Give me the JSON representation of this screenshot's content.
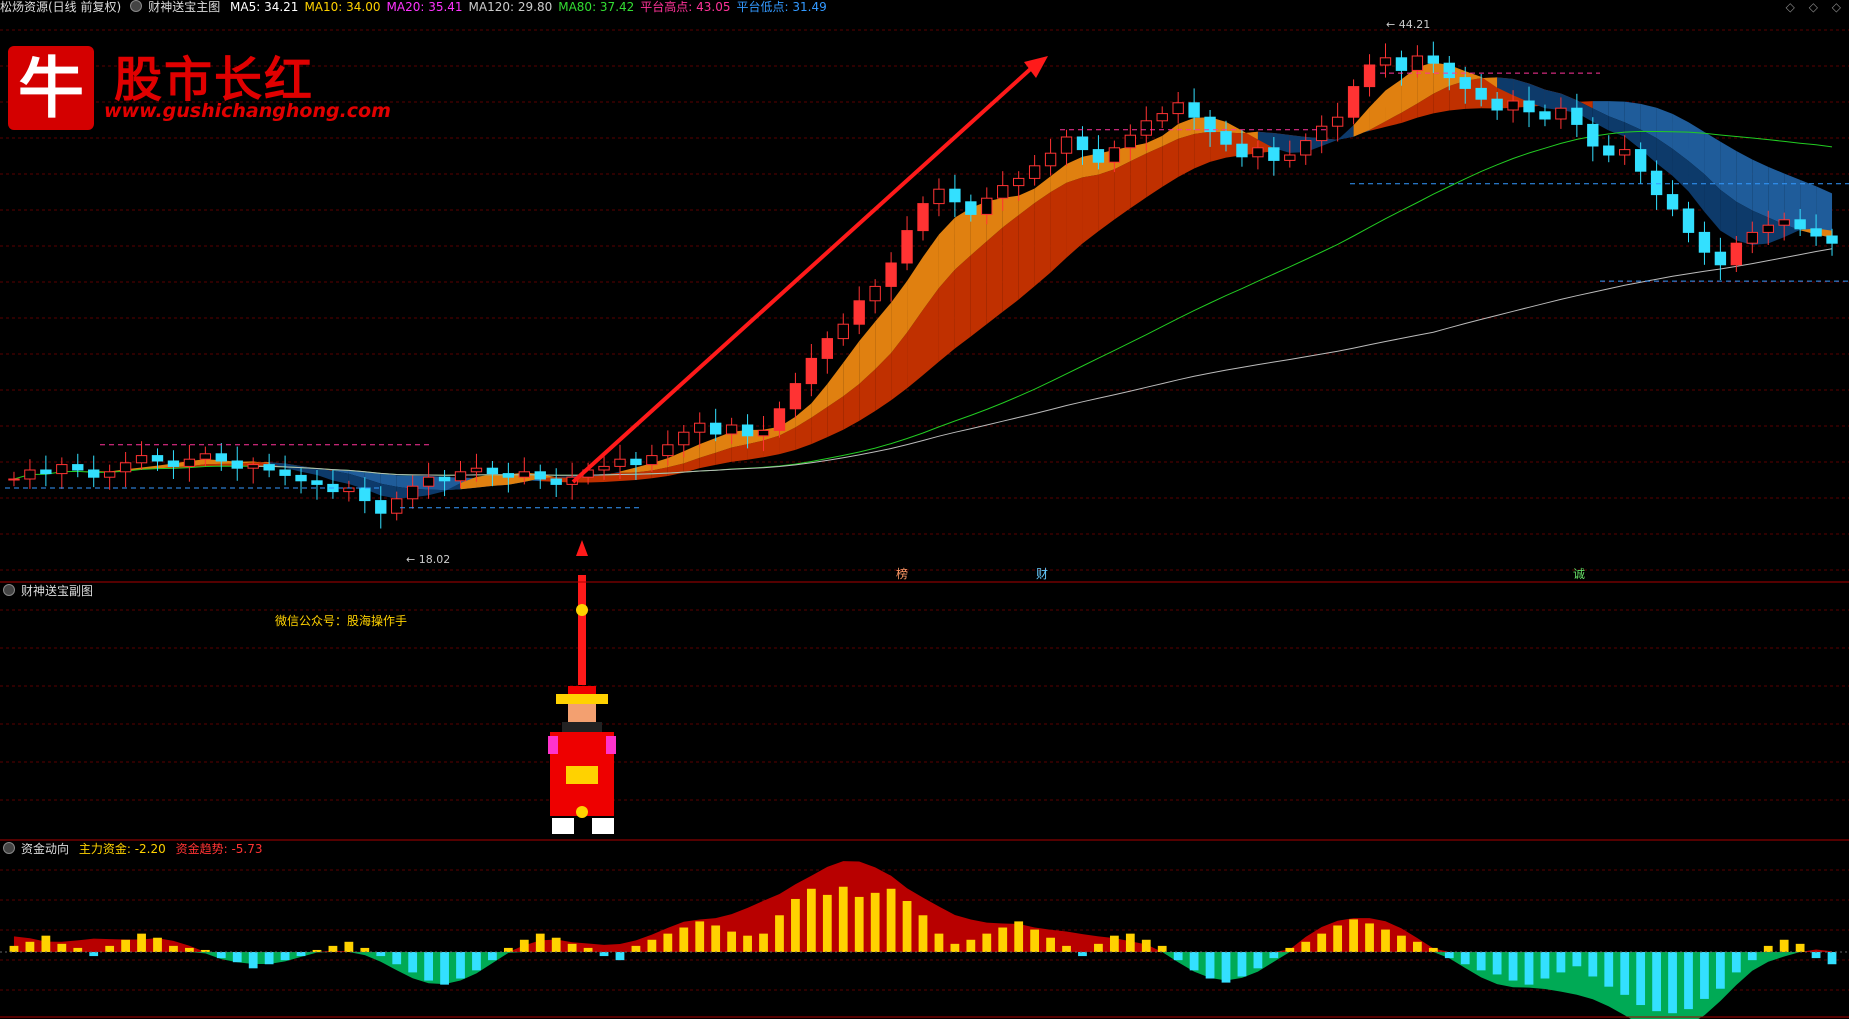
{
  "header": {
    "title": "松炀资源(日线 前复权)",
    "indicator_main": "财神送宝主图",
    "ma": [
      {
        "label": "MA5: 34.21",
        "color": "#ffffff"
      },
      {
        "label": "MA10: 34.00",
        "color": "#ffd200"
      },
      {
        "label": "MA20: 35.41",
        "color": "#ff33ff"
      },
      {
        "label": "MA120: 29.80",
        "color": "#cccccc"
      },
      {
        "label": "MA80: 37.42",
        "color": "#33dd33"
      },
      {
        "label": "平台高点: 43.05",
        "color": "#ff3399"
      },
      {
        "label": "平台低点: 31.49",
        "color": "#3399ff"
      }
    ],
    "right_icons": [
      "◇",
      "◇",
      "◇"
    ]
  },
  "logo": {
    "glyph": "牛",
    "name": "股市长红",
    "url": "www.gushichanghong.com"
  },
  "subchart": {
    "title": "财神送宝副图",
    "wechat": "微信公众号：股海操作手"
  },
  "flow": {
    "title": "资金动向",
    "main_label": "主力资金: -2.20",
    "trend_label": "资金趋势: -5.73",
    "main_color": "#ffd200",
    "trend_color": "#ff3333"
  },
  "markers": [
    {
      "text": "榜",
      "color": "#ff9966"
    },
    {
      "text": "财",
      "color": "#66ccff"
    },
    {
      "text": "诚",
      "color": "#66dd66"
    }
  ],
  "chart_data": {
    "type": "candlestick",
    "price_range": [
      16,
      46
    ],
    "high_label": "44.21",
    "low_label": "18.02",
    "closes": [
      20.5,
      21.0,
      20.8,
      21.3,
      21.0,
      20.6,
      20.9,
      21.4,
      21.8,
      21.5,
      21.2,
      21.6,
      21.9,
      21.5,
      21.1,
      21.3,
      21.0,
      20.7,
      20.4,
      20.2,
      19.8,
      20.0,
      19.3,
      18.6,
      19.4,
      20.1,
      20.6,
      20.4,
      20.9,
      21.1,
      20.8,
      20.6,
      20.9,
      20.5,
      20.2,
      20.6,
      21.0,
      21.2,
      21.6,
      21.3,
      21.8,
      22.4,
      23.1,
      23.6,
      23.0,
      23.5,
      22.9,
      23.2,
      24.4,
      25.8,
      27.2,
      28.3,
      29.1,
      30.4,
      31.2,
      32.5,
      34.3,
      35.8,
      36.6,
      35.9,
      35.2,
      36.1,
      36.8,
      37.2,
      37.9,
      38.6,
      39.5,
      38.8,
      38.1,
      38.9,
      39.6,
      40.4,
      40.8,
      41.4,
      40.6,
      39.8,
      39.1,
      38.4,
      38.9,
      38.2,
      38.5,
      39.3,
      40.1,
      40.6,
      42.3,
      43.5,
      43.9,
      43.2,
      44.0,
      43.6,
      42.8,
      42.2,
      41.6,
      41.0,
      41.5,
      40.9,
      40.5,
      41.1,
      40.2,
      39.0,
      38.5,
      38.8,
      37.6,
      36.3,
      35.5,
      34.2,
      33.1,
      32.4,
      33.6,
      34.2,
      34.6,
      34.9,
      34.4,
      34.0,
      33.6
    ],
    "flow_values": [
      0.3,
      0.5,
      0.8,
      0.4,
      0.2,
      -0.2,
      0.3,
      0.6,
      0.9,
      0.7,
      0.3,
      0.2,
      0.1,
      -0.3,
      -0.5,
      -0.8,
      -0.6,
      -0.4,
      -0.2,
      0.1,
      0.3,
      0.5,
      0.2,
      -0.2,
      -0.6,
      -1.0,
      -1.4,
      -1.6,
      -1.3,
      -0.9,
      -0.4,
      0.2,
      0.6,
      0.9,
      0.7,
      0.4,
      0.2,
      -0.2,
      -0.4,
      0.3,
      0.6,
      0.9,
      1.2,
      1.5,
      1.3,
      1.0,
      0.8,
      0.9,
      1.8,
      2.6,
      3.1,
      2.8,
      3.2,
      2.7,
      2.9,
      3.1,
      2.5,
      1.8,
      0.9,
      0.4,
      0.6,
      0.9,
      1.2,
      1.5,
      1.1,
      0.7,
      0.3,
      -0.2,
      0.4,
      0.8,
      0.9,
      0.6,
      0.3,
      -0.4,
      -0.9,
      -1.3,
      -1.5,
      -1.2,
      -0.8,
      -0.3,
      0.2,
      0.5,
      0.9,
      1.3,
      1.6,
      1.4,
      1.1,
      0.8,
      0.5,
      0.2,
      -0.3,
      -0.6,
      -0.9,
      -1.1,
      -1.4,
      -1.6,
      -1.3,
      -1.0,
      -0.7,
      -1.2,
      -1.7,
      -2.1,
      -2.6,
      -2.9,
      -3.0,
      -2.8,
      -2.3,
      -1.8,
      -1.0,
      -0.4,
      0.3,
      0.6,
      0.4,
      -0.3,
      -0.6
    ]
  }
}
